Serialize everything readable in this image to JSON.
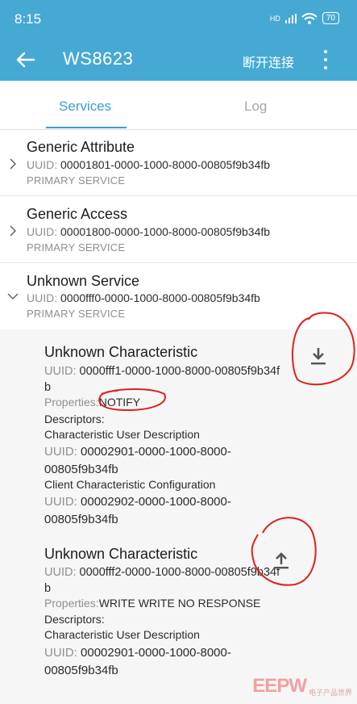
{
  "status_bar": {
    "time": "8:15",
    "signal": "HD",
    "battery": "70"
  },
  "appbar": {
    "title": "WS8623",
    "disconnect_label": "断开连接"
  },
  "tabs": [
    {
      "label": "Services"
    },
    {
      "label": "Log"
    }
  ],
  "services": [
    {
      "name": "Generic Attribute",
      "uuid_label": "UUID:",
      "uuid": "00001801-0000-1000-8000-00805f9b34fb",
      "type": "PRIMARY SERVICE"
    },
    {
      "name": "Generic Access",
      "uuid_label": "UUID:",
      "uuid": "00001800-0000-1000-8000-00805f9b34fb",
      "type": "PRIMARY SERVICE"
    },
    {
      "name": "Unknown Service",
      "uuid_label": "UUID:",
      "uuid": "0000fff0-0000-1000-8000-00805f9b34fb",
      "type": "PRIMARY SERVICE"
    }
  ],
  "characteristics": [
    {
      "name": "Unknown Characteristic",
      "uuid_label": "UUID:",
      "uuid": "0000fff1-0000-1000-8000-00805f9b34fb",
      "properties_label": "Properties:",
      "properties": "NOTIFY",
      "descriptors_label": "Descriptors:",
      "descriptors": [
        {
          "name": "Characteristic User Description",
          "uuid_label": "UUID:",
          "uuid": "00002901-0000-1000-8000-00805f9b34fb"
        },
        {
          "name": "Client Characteristic Configuration",
          "uuid_label": "UUID:",
          "uuid": "00002902-0000-1000-8000-00805f9b34fb"
        }
      ],
      "action_icon": "download-icon"
    },
    {
      "name": "Unknown Characteristic",
      "uuid_label": "UUID:",
      "uuid": "0000fff2-0000-1000-8000-00805f9b34fb",
      "properties_label": "Properties:",
      "properties": "WRITE WRITE NO RESPONSE",
      "descriptors_label": "Descriptors:",
      "descriptors": [
        {
          "name": "Characteristic User Description",
          "uuid_label": "UUID:",
          "uuid": "00002901-0000-1000-8000-00805f9b34fb"
        }
      ],
      "action_icon": "upload-icon"
    }
  ],
  "watermark": {
    "logo": "EEPW",
    "sub": "电子产品世界"
  },
  "colors": {
    "primary": "#46a9d3",
    "accent": "#3a9fd0",
    "annotation": "#e0201a"
  }
}
